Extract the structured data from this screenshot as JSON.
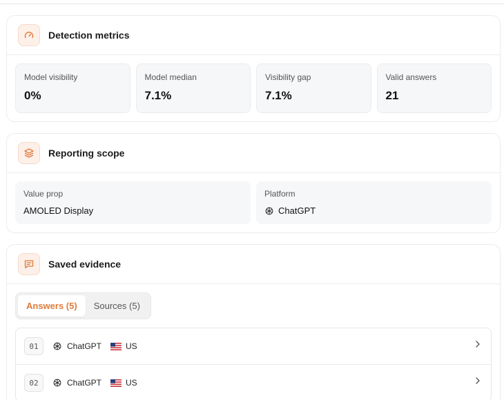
{
  "detection": {
    "title": "Detection metrics",
    "metrics": [
      {
        "label": "Model visibility",
        "value": "0%"
      },
      {
        "label": "Model median",
        "value": "7.1%"
      },
      {
        "label": "Visibility gap",
        "value": "7.1%"
      },
      {
        "label": "Valid answers",
        "value": "21"
      }
    ]
  },
  "scope": {
    "title": "Reporting scope",
    "value_prop_label": "Value prop",
    "value_prop": "AMOLED Display",
    "platform_label": "Platform",
    "platform": "ChatGPT"
  },
  "evidence": {
    "title": "Saved evidence",
    "tabs": [
      {
        "label": "Answers (5)",
        "active": true
      },
      {
        "label": "Sources (5)",
        "active": false
      }
    ],
    "answers": [
      {
        "num": "01",
        "platform": "ChatGPT",
        "country": "US"
      },
      {
        "num": "02",
        "platform": "ChatGPT",
        "country": "US"
      }
    ]
  },
  "colors": {
    "accent": "#e07a3a",
    "icon_bg": "#fdf0e9"
  },
  "icons": {
    "detection": "gauge-icon",
    "scope": "layers-icon",
    "evidence": "message-square-icon",
    "platform": "openai-icon",
    "country_flag": "us-flag-icon",
    "row_action": "chevron-right-icon"
  }
}
